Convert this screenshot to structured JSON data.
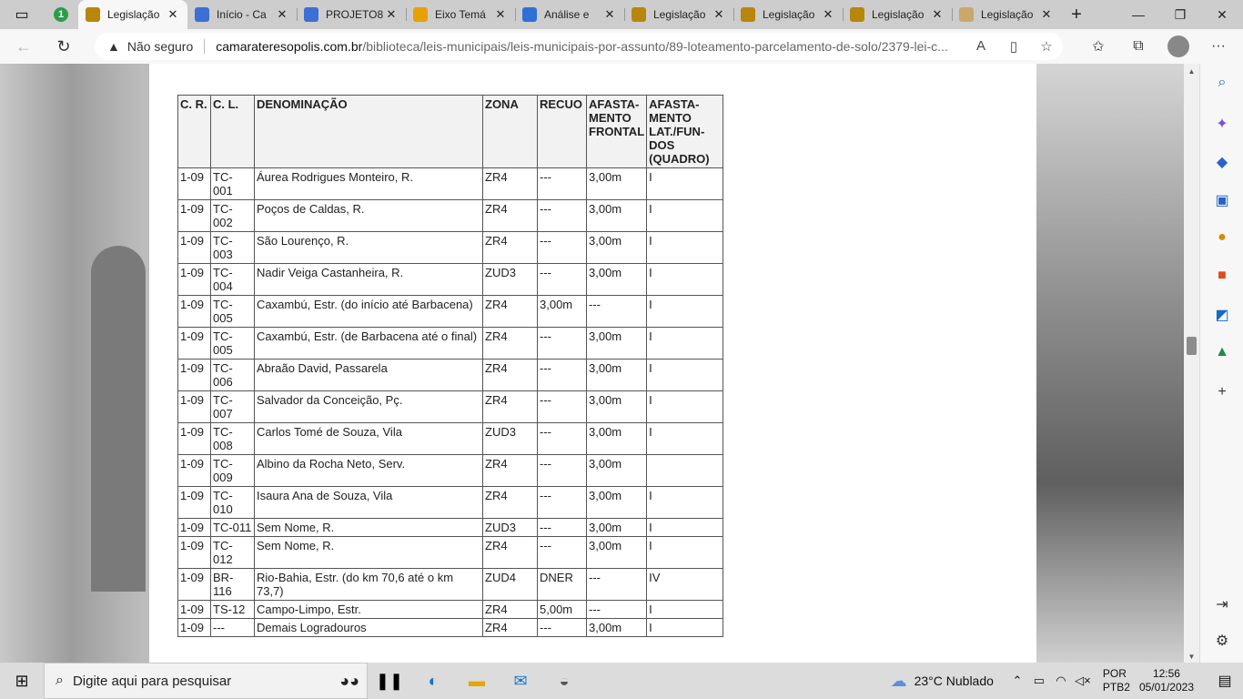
{
  "browser": {
    "tabs": [
      {
        "label": "",
        "badge": "1",
        "color": "#2a9d4a"
      },
      {
        "label": "Legislação",
        "color": "#b8860b",
        "active": true
      },
      {
        "label": "Início - Ca",
        "color": "#3b6fd6"
      },
      {
        "label": "PROJETO8",
        "color": "#3b6fd6"
      },
      {
        "label": "Eixo Temá",
        "color": "#e8a000"
      },
      {
        "label": "Análise e",
        "color": "#2f6fd8"
      },
      {
        "label": "Legislação",
        "color": "#b8860b"
      },
      {
        "label": "Legislação",
        "color": "#b8860b"
      },
      {
        "label": "Legislação",
        "color": "#b8860b"
      },
      {
        "label": "Legislação",
        "color": "#c9a86a"
      }
    ],
    "security_label": "Não seguro",
    "url_host": "camarateresopolis.com.br",
    "url_path": "/biblioteca/leis-municipais/leis-municipais-por-assunto/89-loteamento-parcelamento-de-solo/2379-lei-c..."
  },
  "table": {
    "headers": [
      "C. R.",
      "C. L.",
      "DENOMINAÇÃO",
      "ZONA",
      "RECUO",
      "AFASTA-MENTO FRONTAL",
      "AFASTA-MENTO LAT./FUN-DOS (QUADRO)"
    ],
    "rows": [
      [
        "1-09",
        "TC-001",
        "Áurea Rodrigues Monteiro, R.",
        "ZR4",
        "---",
        "3,00m",
        "I"
      ],
      [
        "1-09",
        "TC-002",
        "Poços de Caldas, R.",
        "ZR4",
        "---",
        "3,00m",
        "I"
      ],
      [
        "1-09",
        "TC-003",
        "São Lourenço, R.",
        "ZR4",
        "---",
        "3,00m",
        "I"
      ],
      [
        "1-09",
        "TC-004",
        "Nadir Veiga Castanheira, R.",
        "ZUD3",
        "---",
        "3,00m",
        "I"
      ],
      [
        "1-09",
        "TC-005",
        "Caxambú, Estr. (do início até Barbacena)",
        "ZR4",
        "3,00m",
        "---",
        "I"
      ],
      [
        "1-09",
        "TC-005",
        "Caxambú, Estr. (de Barbacena até o final)",
        "ZR4",
        "---",
        "3,00m",
        "I"
      ],
      [
        "1-09",
        "TC-006",
        "Abraão David, Passarela",
        "ZR4",
        "---",
        "3,00m",
        "I"
      ],
      [
        "1-09",
        "TC-007",
        "Salvador da Conceição, Pç.",
        "ZR4",
        "---",
        "3,00m",
        "I"
      ],
      [
        "1-09",
        "TC-008",
        "Carlos Tomé de Souza, Vila",
        "ZUD3",
        "---",
        "3,00m",
        "I"
      ],
      [
        "1-09",
        "TC-009",
        "Albino da Rocha Neto, Serv.",
        "ZR4",
        "---",
        "3,00m",
        ""
      ],
      [
        "1-09",
        "TC-010",
        "Isaura Ana de Souza, Vila",
        "ZR4",
        "---",
        "3,00m",
        "I"
      ],
      [
        "1-09",
        "TC-011",
        "Sem Nome, R.",
        "ZUD3",
        "---",
        "3,00m",
        "I"
      ],
      [
        "1-09",
        "TC-012",
        "Sem Nome, R.",
        "ZR4",
        "---",
        "3,00m",
        "I"
      ],
      [
        "1-09",
        "BR-116",
        "Rio-Bahia, Estr. (do km 70,6 até o km 73,7)",
        "ZUD4",
        "DNER",
        "---",
        "IV"
      ],
      [
        "1-09",
        "TS-12",
        "Campo-Limpo, Estr.",
        "ZR4",
        "5,00m",
        "---",
        "I"
      ],
      [
        "1-09",
        "---",
        "Demais Logradouros",
        "ZR4",
        "---",
        "3,00m",
        "I"
      ]
    ]
  },
  "taskbar": {
    "search_placeholder": "Digite aqui para pesquisar",
    "temperature": "23°C",
    "weather": "Nublado",
    "lang_1": "POR",
    "lang_2": "PTB2",
    "time": "12:56",
    "date": "05/01/2023"
  }
}
